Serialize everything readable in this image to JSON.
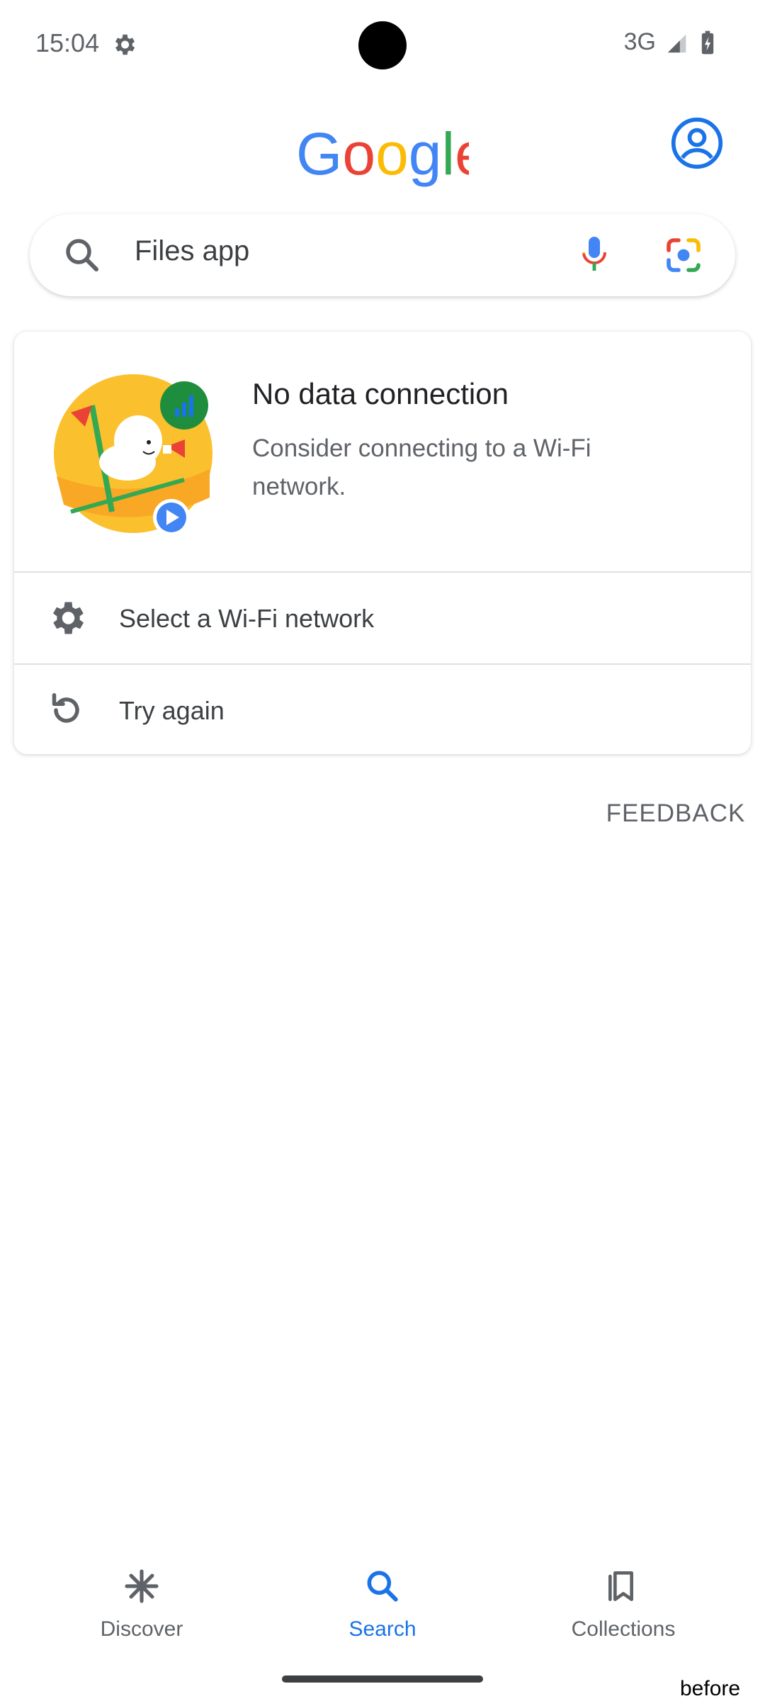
{
  "status_bar": {
    "time": "15:04",
    "network": "3G"
  },
  "header": {
    "logo_text": "Google"
  },
  "search": {
    "query": "Files app"
  },
  "card": {
    "title": "No data connection",
    "body": "Consider connecting to a Wi-Fi network.",
    "actions": [
      {
        "label": "Select a Wi-Fi network",
        "icon": "gear-icon"
      },
      {
        "label": "Try again",
        "icon": "refresh-icon"
      }
    ]
  },
  "feedback_label": "FEEDBACK",
  "bottom_nav": {
    "items": [
      {
        "label": "Discover",
        "icon": "asterisk-icon",
        "active": false
      },
      {
        "label": "Search",
        "icon": "search-icon",
        "active": true
      },
      {
        "label": "Collections",
        "icon": "bookmarks-icon",
        "active": false
      }
    ]
  },
  "corner_note": "before",
  "colors": {
    "accent": "#1a73e8",
    "text_secondary": "#5f6368",
    "google_blue": "#4285F4",
    "google_red": "#EA4335",
    "google_yellow": "#FBBC05",
    "google_green": "#34A853"
  }
}
